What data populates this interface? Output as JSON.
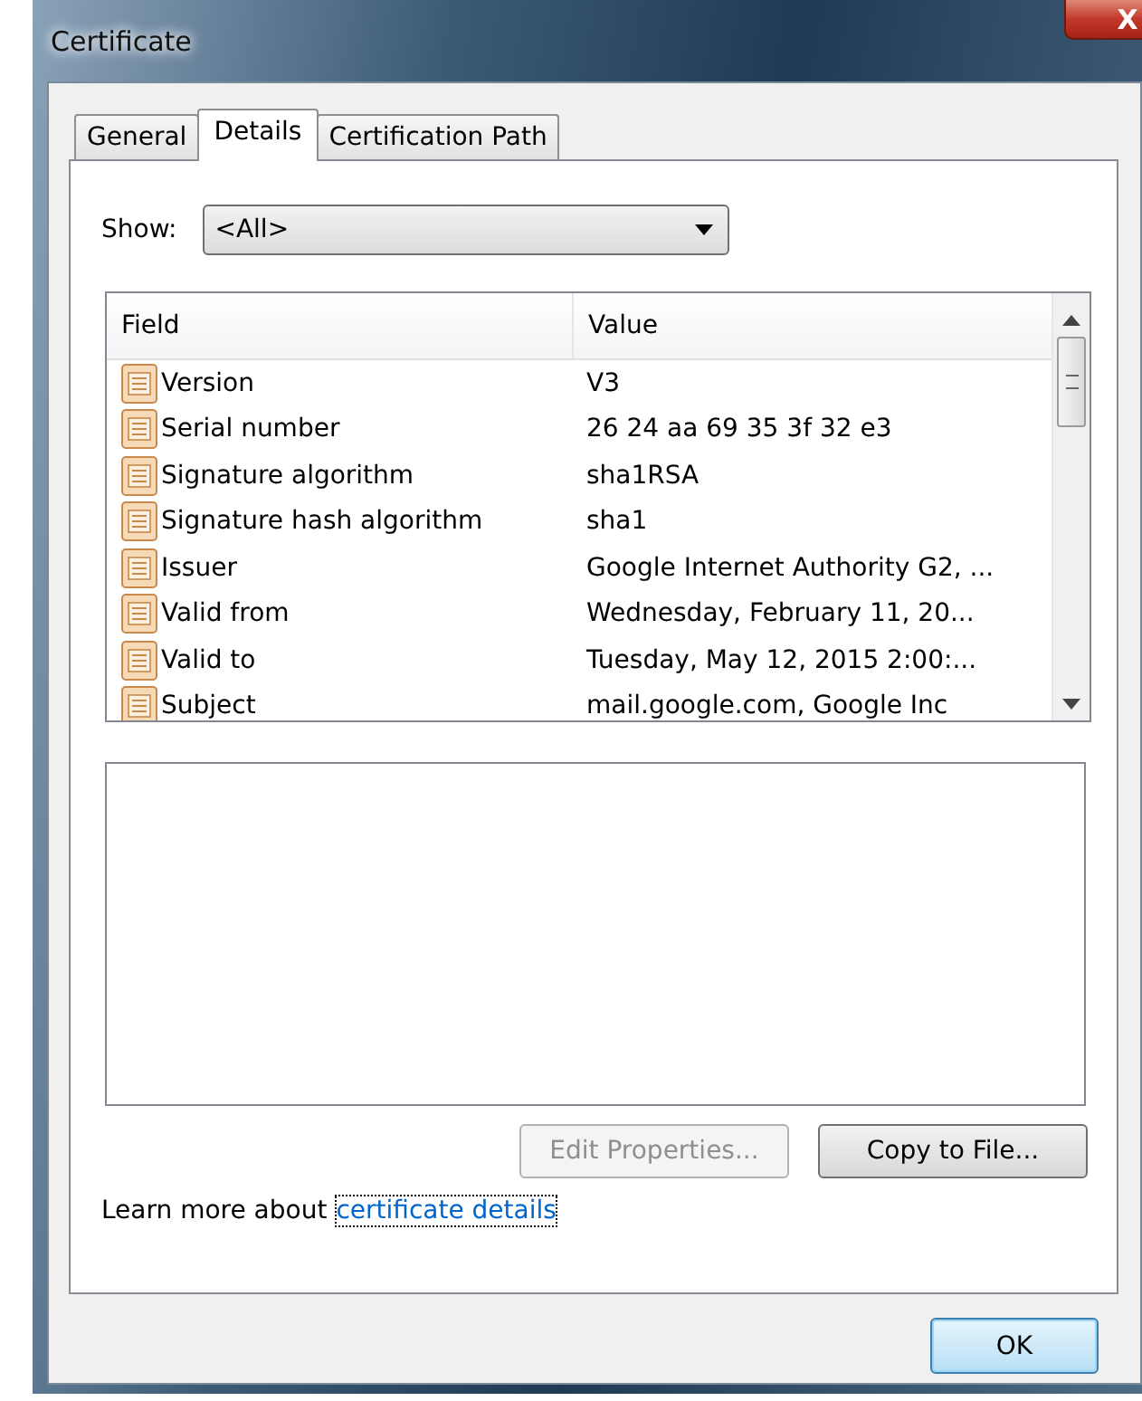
{
  "window": {
    "title": "Certificate",
    "close_label": "X"
  },
  "tabs": [
    {
      "label": "General",
      "selected": false
    },
    {
      "label": "Details",
      "selected": true
    },
    {
      "label": "Certification Path",
      "selected": false
    }
  ],
  "show": {
    "label": "Show:",
    "value": "<All>"
  },
  "table": {
    "columns": [
      "Field",
      "Value"
    ],
    "rows": [
      {
        "field": "Version",
        "value": "V3"
      },
      {
        "field": "Serial number",
        "value": "26 24 aa 69 35 3f 32 e3"
      },
      {
        "field": "Signature algorithm",
        "value": "sha1RSA"
      },
      {
        "field": "Signature hash algorithm",
        "value": "sha1"
      },
      {
        "field": "Issuer",
        "value": "Google Internet Authority G2, ..."
      },
      {
        "field": "Valid from",
        "value": "Wednesday, February 11, 20..."
      },
      {
        "field": "Valid to",
        "value": "Tuesday, May 12, 2015 2:00:..."
      },
      {
        "field": "Subject",
        "value": "mail.google.com, Google Inc"
      }
    ]
  },
  "buttons": [
    {
      "label": "Edit Properties...",
      "disabled": true
    },
    {
      "label": "Copy to File...",
      "disabled": false
    }
  ],
  "learn_more": {
    "text": "Learn more about",
    "link": "certificate details"
  },
  "ok_button": "OK"
}
